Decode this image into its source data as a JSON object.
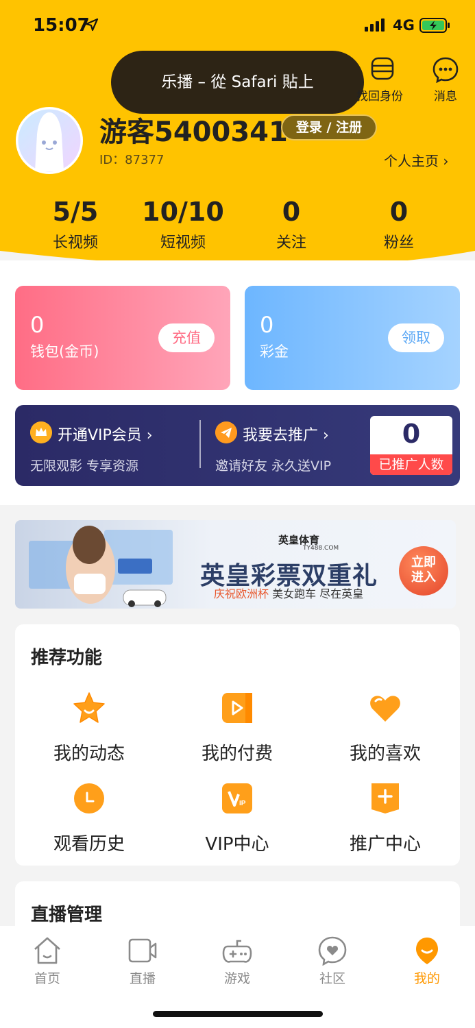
{
  "status_bar": {
    "time": "15:07",
    "network": "4G"
  },
  "toast": {
    "text": "乐播 – 從 Safari 貼上"
  },
  "top_actions": {
    "identity_label": "找回身份",
    "message_label": "消息"
  },
  "profile": {
    "username": "游客5400341",
    "login_label": "登录 / 注册",
    "id_text": "ID：87377",
    "homepage_link": "个人主页 ›"
  },
  "stats": [
    {
      "value": "5/5",
      "label": "长视频"
    },
    {
      "value": "10/10",
      "label": "短视频"
    },
    {
      "value": "0",
      "label": "关注"
    },
    {
      "value": "0",
      "label": "粉丝"
    }
  ],
  "wallet": {
    "coins": {
      "value": "0",
      "label": "钱包(金币)",
      "button": "充值"
    },
    "bonus": {
      "value": "0",
      "label": "彩金",
      "button": "领取"
    }
  },
  "vip_bar": {
    "vip_title": "开通VIP会员 ›",
    "vip_sub": "无限观影 专享资源",
    "promo_title": "我要去推广 ›",
    "promo_sub": "邀请好友 永久送VIP",
    "promo_count": "0",
    "promo_count_label": "已推广人数"
  },
  "banner": {
    "brand": "英皇体育",
    "brand_sub": "TY488.COM",
    "headline": "英皇彩票双重礼",
    "tagline_highlight": "庆祝欧洲杯",
    "tagline_rest": " 美女跑车 尽在英皇",
    "enter_line1": "立即",
    "enter_line2": "进入"
  },
  "recommended": {
    "title": "推荐功能",
    "items": [
      {
        "label": "我的动态",
        "icon": "star-icon"
      },
      {
        "label": "我的付费",
        "icon": "play-icon"
      },
      {
        "label": "我的喜欢",
        "icon": "heart-icon"
      },
      {
        "label": "观看历史",
        "icon": "clock-icon"
      },
      {
        "label": "VIP中心",
        "icon": "vip-icon"
      },
      {
        "label": "推广中心",
        "icon": "plus-icon"
      }
    ]
  },
  "live_management": {
    "title": "直播管理"
  },
  "tabbar": {
    "items": [
      {
        "label": "首页",
        "icon": "home-icon"
      },
      {
        "label": "直播",
        "icon": "video-icon"
      },
      {
        "label": "游戏",
        "icon": "gamepad-icon"
      },
      {
        "label": "社区",
        "icon": "community-icon"
      },
      {
        "label": "我的",
        "icon": "profile-icon",
        "active": true
      }
    ]
  },
  "colors": {
    "header_yellow": "#ffc300",
    "accent_orange": "#ff9800",
    "vip_navy": "#2b2a66"
  }
}
